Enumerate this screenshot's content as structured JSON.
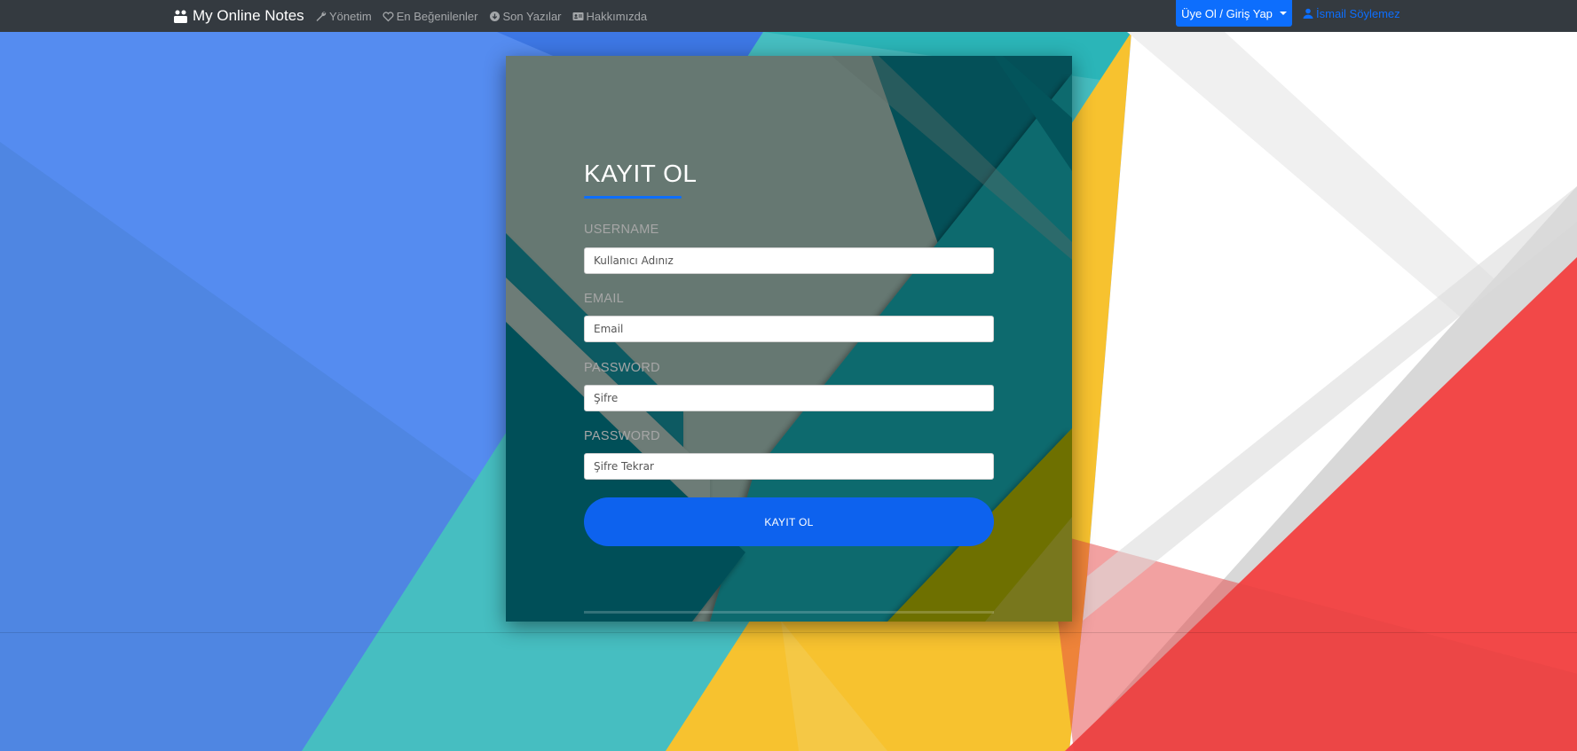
{
  "navbar": {
    "brand": "My Online Notes",
    "links": [
      {
        "label": "Yönetim",
        "icon": "wrench-icon"
      },
      {
        "label": "En Beğenilenler",
        "icon": "heart-icon"
      },
      {
        "label": "Son Yazılar",
        "icon": "arrow-circle-down-icon"
      },
      {
        "label": "Hakkımızda",
        "icon": "id-card-icon"
      }
    ],
    "dropdown_label": "Üye Ol / Giriş Yap",
    "user_label": "İsmail Söylemez"
  },
  "form": {
    "title": "KAYIT OL",
    "fields": [
      {
        "label": "USERNAME",
        "placeholder": "Kullanıcı Adınız"
      },
      {
        "label": "EMAIL",
        "placeholder": "Email"
      },
      {
        "label": "PASSWORD",
        "placeholder": "Şifre"
      },
      {
        "label": "PASSWORD",
        "placeholder": "Şifre Tekrar"
      }
    ],
    "submit_label": "KAYIT OL"
  },
  "colors": {
    "navbar": "#343a40",
    "primary": "#0d6efd",
    "bg_blue": "#4f86e8",
    "bg_teal": "#46bec1",
    "bg_yellow": "#f7c22f",
    "bg_red": "#f24848",
    "card_gray": "#667872",
    "card_teal": "#0a6a6e"
  }
}
